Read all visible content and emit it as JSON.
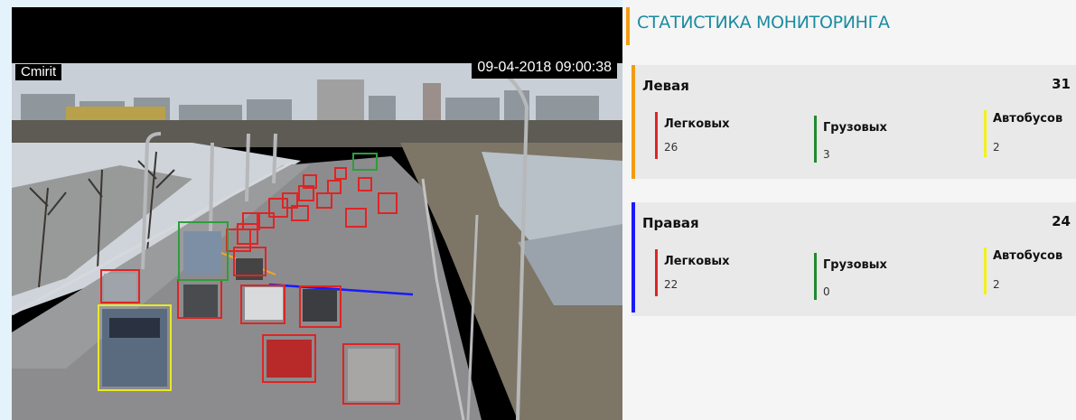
{
  "camera": {
    "name_overlay": "Cmirit",
    "timestamp": "09-04-2018 09:00:38",
    "detections": [
      {
        "type": "car"
      },
      {
        "type": "car"
      },
      {
        "type": "car"
      },
      {
        "type": "car"
      },
      {
        "type": "car"
      },
      {
        "type": "car"
      },
      {
        "type": "car"
      },
      {
        "type": "car"
      },
      {
        "type": "car"
      },
      {
        "type": "car"
      },
      {
        "type": "car"
      },
      {
        "type": "car"
      },
      {
        "type": "car"
      },
      {
        "type": "car"
      },
      {
        "type": "car"
      },
      {
        "type": "car"
      },
      {
        "type": "car"
      },
      {
        "type": "car"
      },
      {
        "type": "car"
      },
      {
        "type": "car"
      },
      {
        "type": "car"
      },
      {
        "type": "truck"
      },
      {
        "type": "truck"
      },
      {
        "type": "bus"
      }
    ],
    "colors": {
      "car": "#e02424",
      "truck": "#2e9e3a",
      "bus": "#e8e82a",
      "left_line": "#f5a623",
      "right_line": "#1a1aff"
    }
  },
  "stats": {
    "title": "СТАТИСТИКА МОНИТОРИНГА",
    "title_accent": "#f39c12",
    "sides": [
      {
        "name": "Левая",
        "total": "31",
        "accent": "#f39c12",
        "metrics": [
          {
            "label": "Легковых",
            "value": "26",
            "color": "#e02424"
          },
          {
            "label": "Грузовых",
            "value": "3",
            "color": "#1f8a2e"
          },
          {
            "label": "Автобусов",
            "value": "2",
            "color": "#f2f21a"
          }
        ]
      },
      {
        "name": "Правая",
        "total": "24",
        "accent": "#1a1aff",
        "metrics": [
          {
            "label": "Легковых",
            "value": "22",
            "color": "#e02424"
          },
          {
            "label": "Грузовых",
            "value": "0",
            "color": "#1f8a2e"
          },
          {
            "label": "Автобусов",
            "value": "2",
            "color": "#f2f21a"
          }
        ]
      }
    ]
  }
}
